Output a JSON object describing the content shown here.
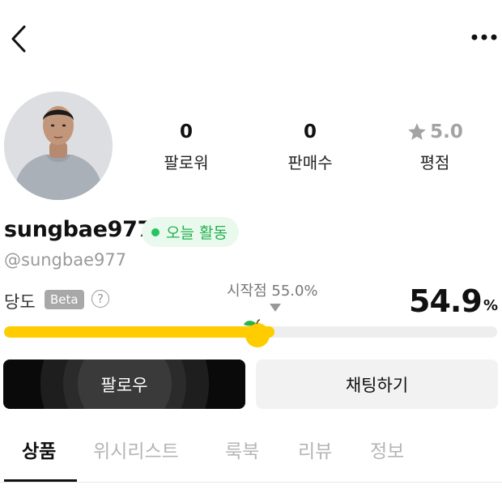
{
  "profile": {
    "username": "sungbae977",
    "handle": "@sungbae977",
    "active_badge": "오늘 활동"
  },
  "stats": {
    "followers_value": "0",
    "followers_label": "팔로워",
    "sales_value": "0",
    "sales_label": "판매수",
    "rating_value": "5.0",
    "rating_label": "평점"
  },
  "sweetness": {
    "label": "당도",
    "beta": "Beta",
    "help": "?",
    "start_text": "시작점 55.0%",
    "value": "54.9",
    "unit": "%",
    "progress": 0.549
  },
  "buttons": {
    "follow": "팔로우",
    "chat": "채팅하기"
  },
  "tabs": [
    {
      "label": "상품",
      "active": true
    },
    {
      "label": "위시리스트",
      "active": false
    },
    {
      "label": "룩북",
      "active": false
    },
    {
      "label": "리뷰",
      "active": false
    },
    {
      "label": "정보",
      "active": false
    }
  ],
  "colors": {
    "accent_yellow": "#ffcc00",
    "active_green": "#22c55e",
    "follow_bg": "#0a0a0a"
  },
  "icons": {
    "back": "chevron-left-icon",
    "more": "more-horizontal-icon",
    "rating": "star-icon",
    "sweetness_marker": "apple-icon"
  }
}
